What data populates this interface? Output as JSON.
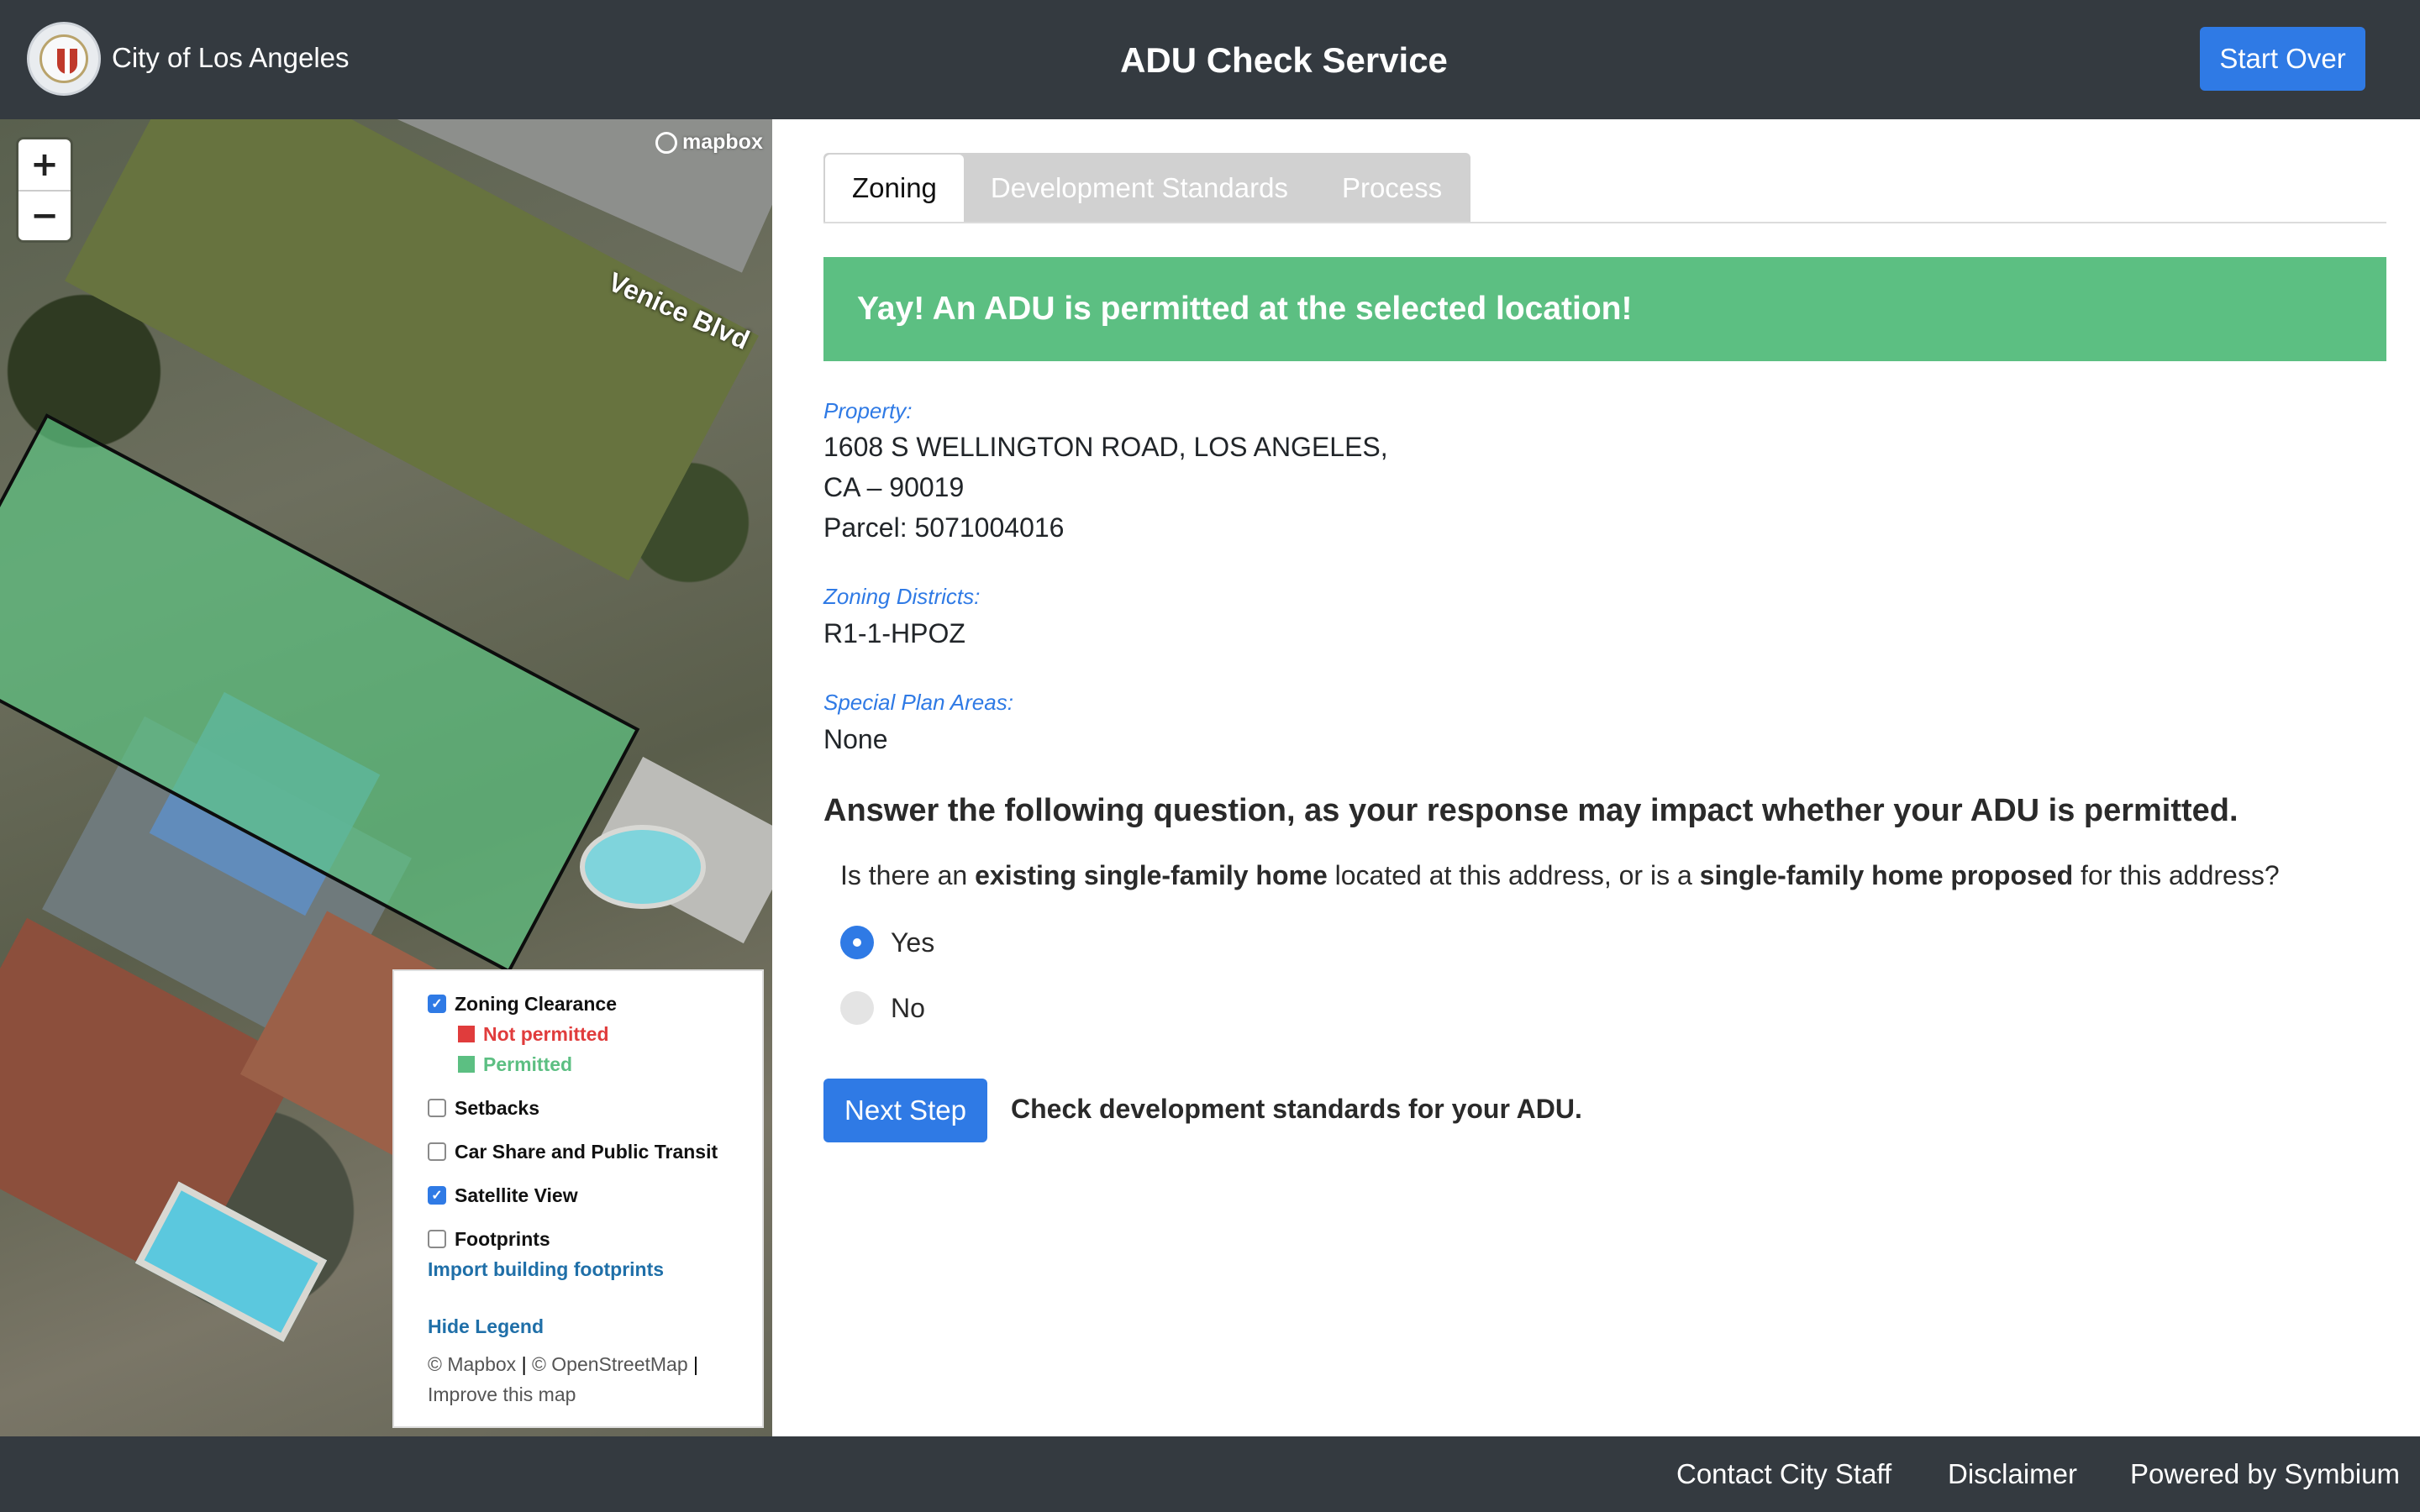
{
  "header": {
    "city_name": "City of Los Angeles",
    "app_title": "ADU Check Service",
    "start_over_label": "Start Over"
  },
  "map": {
    "zoom_in": "+",
    "zoom_out": "−",
    "logo_text": "mapbox",
    "street_label": "Venice Blvd",
    "legend": {
      "zoning_clearance": {
        "label": "Zoning Clearance",
        "checked": true
      },
      "not_permitted": {
        "label": "Not permitted",
        "color": "#e03c3c"
      },
      "permitted": {
        "label": "Permitted",
        "color": "#5cbf82"
      },
      "setbacks": {
        "label": "Setbacks",
        "checked": false
      },
      "car_share": {
        "label": "Car Share and Public Transit",
        "checked": false
      },
      "satellite": {
        "label": "Satellite View",
        "checked": true
      },
      "footprints": {
        "label": "Footprints",
        "checked": false
      },
      "import_link": "Import building footprints",
      "hide_legend": "Hide Legend",
      "attrib_mapbox": "© Mapbox",
      "attrib_osm": "© OpenStreetMap",
      "attrib_improve": "Improve this map"
    }
  },
  "tabs": [
    "Zoning",
    "Development Standards",
    "Process"
  ],
  "alert": "Yay! An ADU is permitted at the selected location!",
  "property": {
    "label": "Property:",
    "address_line1": "1608 S WELLINGTON ROAD, LOS ANGELES,",
    "address_line2": "CA – 90019",
    "parcel": "Parcel: 5071004016"
  },
  "zoning": {
    "label": "Zoning Districts:",
    "value": "R1-1-HPOZ"
  },
  "special": {
    "label": "Special Plan Areas:",
    "value": "None"
  },
  "question": {
    "heading": "Answer the following question, as your response may impact whether your ADU is permitted.",
    "t1": "Is there an ",
    "b1": "existing single-family home",
    "t2": " located at this address, or is a ",
    "b2": "single-family home proposed",
    "t3": " for this address?",
    "options": [
      "Yes",
      "No"
    ],
    "selected": "Yes"
  },
  "next": {
    "button": "Next Step",
    "desc": "Check development standards for your ADU."
  },
  "footer": {
    "contact": "Contact City Staff",
    "disclaimer": "Disclaimer",
    "powered": "Powered by Symbium"
  },
  "colors": {
    "accent": "#2f7ae5",
    "header_bg": "#343a40",
    "success": "#5cbf82"
  }
}
